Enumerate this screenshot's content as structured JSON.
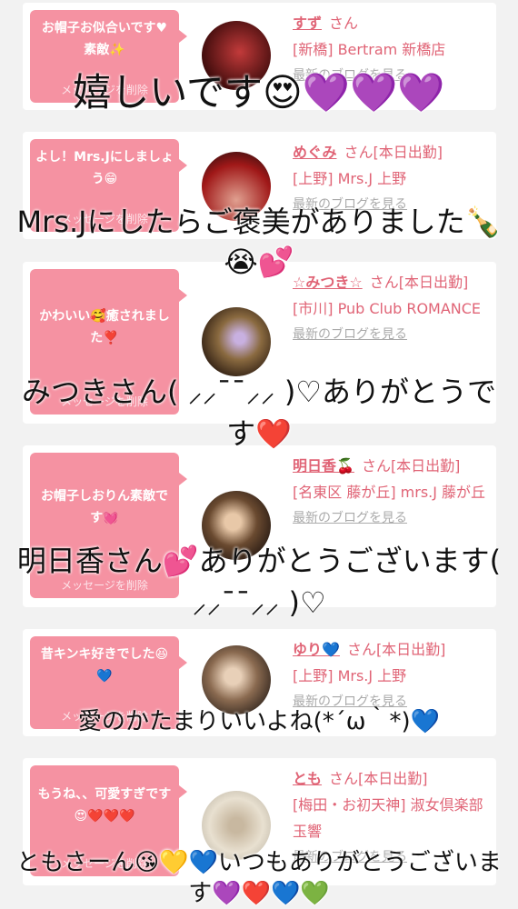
{
  "cards": [
    {
      "message": "お帽子お似合いです♥素敵✨",
      "delete_label": "メッセージを削除",
      "name": "すず",
      "suffix": "さん",
      "detail": "[新橋] Bertram 新橋店",
      "blog": "最新のブログを見る",
      "avatar_color": "#8b1e1e"
    },
    {
      "message": "よし！Mrs.Jにしましょう😁",
      "delete_label": "メッセージを削除",
      "name": "めぐみ",
      "suffix": "さん[本日出勤]",
      "detail": "[上野] Mrs.J 上野",
      "blog": "最新のブログを見る",
      "avatar_color": "#b02a2a"
    },
    {
      "message": "かわいい🥰癒されました❣️",
      "delete_label": "メッセージを削除",
      "name": "☆みつき☆",
      "suffix": "さん[本日出勤]",
      "detail": "[市川] Pub Club ROMANCE",
      "blog": "最新のブログを見る",
      "avatar_color": "#6b4a2a"
    },
    {
      "message": "お帽子しおりん素敵です💓",
      "delete_label": "メッセージを削除",
      "name": "明日香🍒",
      "suffix": "さん[本日出勤]",
      "detail": "[名東区 藤が丘] mrs.J 藤が丘",
      "blog": "最新のブログを見る",
      "avatar_color": "#4a3020"
    },
    {
      "message": "昔キンキ好きでした😆💙",
      "delete_label": "メッセージを削除",
      "name": "ゆり💙",
      "suffix": "さん[本日出勤]",
      "detail": "[上野] Mrs.J 上野",
      "blog": "最新のブログを見る",
      "avatar_color": "#3a2a20"
    },
    {
      "message": "もうね、、可愛すぎです😍❤️❤️❤️",
      "delete_label": "メッセージを削除",
      "name": "とも",
      "suffix": "さん[本日出勤]",
      "detail": "[梅田・お初天神] 淑女倶楽部 玉響",
      "blog": "最新のブログを見る",
      "avatar_color": "#d8d0c0"
    }
  ],
  "captions": [
    "嬉しいです😍💜💜💜",
    "Mrs.Jにしたらご褒美がありました🍾😭💕",
    "みつきさん( ⸝⸝¯¯⸝⸝ )♡ありがとうです❤️",
    "明日香さん💕ありがとうございます( ⸝⸝¯¯⸝⸝ )♡",
    "愛のかたまりいいよね(*´ω｀*)💙",
    "ともさーん😘💛💙いつもありがとうございます💜❤️💙💚"
  ]
}
